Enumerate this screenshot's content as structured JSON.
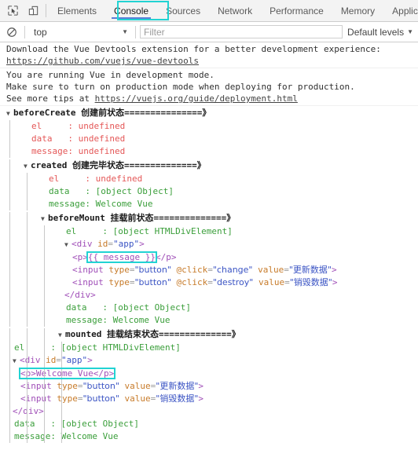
{
  "toolbar": {
    "inspect_icon": "inspect-element-icon",
    "device_icon": "device-toolbar-icon",
    "tabs": [
      {
        "label": "Elements",
        "active": false
      },
      {
        "label": "Console",
        "active": true
      },
      {
        "label": "Sources",
        "active": false
      },
      {
        "label": "Network",
        "active": false
      },
      {
        "label": "Performance",
        "active": false
      },
      {
        "label": "Memory",
        "active": false
      },
      {
        "label": "Applicatio",
        "active": false
      }
    ]
  },
  "filterbar": {
    "clear_icon": "clear-console-icon",
    "context": "top",
    "context_caret": "▼",
    "filter_placeholder": "Filter",
    "filter_value": "",
    "levels_label": "Default levels",
    "levels_caret": "▼"
  },
  "highlights": {
    "accent": "#22d3d3",
    "tab_target": "Console",
    "console_target_1": "{{ message }}",
    "console_target_2": "p>Welcome Vue</p>"
  },
  "console": {
    "messages": [
      {
        "lines": [
          "Download the Vue Devtools extension for a better development experience:",
          "https://github.com/vuejs/vue-devtools"
        ]
      },
      {
        "lines": [
          "You are running Vue in development mode.",
          "Make sure to turn on production mode when deploying for production.",
          "See more tips at https://vuejs.org/guide/deployment.html"
        ]
      }
    ],
    "groups": [
      {
        "name": "beforeCreate",
        "title_cn": "创建前状态",
        "title_rule": "===============》",
        "rows": [
          {
            "key": "el",
            "pad": "     ",
            "sep": ": ",
            "value": "undefined",
            "color": "red"
          },
          {
            "key": "data",
            "pad": "   ",
            "sep": ": ",
            "value": "undefined",
            "color": "red"
          },
          {
            "key": "message",
            "pad": "",
            "sep": ": ",
            "value": "undefined",
            "color": "red"
          }
        ]
      },
      {
        "name": "created",
        "title_cn": "创建完毕状态",
        "title_rule": "==============》",
        "rows": [
          {
            "key": "el",
            "pad": "     ",
            "sep": ": ",
            "value": "undefined",
            "color": "red"
          },
          {
            "key": "data",
            "pad": "   ",
            "sep": ": ",
            "value": "[object Object]",
            "color": "green"
          },
          {
            "key": "message",
            "pad": "",
            "sep": ": ",
            "value": "Welcome Vue",
            "color": "green"
          }
        ]
      },
      {
        "name": "beforeMount",
        "title_cn": "挂载前状态",
        "title_rule": "==============》",
        "rows": [
          {
            "key": "el",
            "pad": "     ",
            "sep": ": ",
            "value": "[object HTMLDivElement]",
            "color": "green"
          }
        ],
        "dom": {
          "open_tag": {
            "lt": "<",
            "name": "div",
            "space": " ",
            "attr": "id",
            "eq": "=",
            "value": "\"app\"",
            "gt": ">"
          },
          "children": [
            {
              "type": "p_mustache",
              "before": "<p>",
              "mustache": "{{ message }}",
              "after": "</p>"
            },
            {
              "type": "input",
              "tag": "<input",
              "attrs": [
                {
                  "name": " type",
                  "eq": "=",
                  "value": "\"button\""
                },
                {
                  "name": " @click",
                  "eq": "=",
                  "value": "\"change\""
                },
                {
                  "name": " value",
                  "eq": "=",
                  "value": "\"更新数据\""
                }
              ],
              "close": ">"
            },
            {
              "type": "input",
              "tag": "<input",
              "attrs": [
                {
                  "name": " type",
                  "eq": "=",
                  "value": "\"button\""
                },
                {
                  "name": " @click",
                  "eq": "=",
                  "value": "\"destroy\""
                },
                {
                  "name": " value",
                  "eq": "=",
                  "value": "\"销毁数据\""
                }
              ],
              "close": ">"
            }
          ],
          "close_tag": "</div>"
        },
        "rows_after": [
          {
            "key": "data",
            "pad": "   ",
            "sep": ": ",
            "value": "[object Object]",
            "color": "green"
          },
          {
            "key": "message",
            "pad": "",
            "sep": ": ",
            "value": "Welcome Vue",
            "color": "green"
          }
        ]
      },
      {
        "name": "mounted",
        "title_cn": "挂载结束状态",
        "title_rule": "==============》",
        "rows": [
          {
            "key": "el",
            "pad": "     ",
            "sep": ": ",
            "value": "[object HTMLDivElement]",
            "color": "green"
          }
        ],
        "dom": {
          "open_tag": {
            "lt": "<",
            "name": "div",
            "space": " ",
            "attr": "id",
            "eq": "=",
            "value": "\"app\"",
            "gt": ">"
          },
          "children": [
            {
              "type": "p_text",
              "text": "<p>Welcome Vue</p>"
            },
            {
              "type": "input",
              "tag": "<input",
              "attrs": [
                {
                  "name": " type",
                  "eq": "=",
                  "value": "\"button\""
                },
                {
                  "name": " value",
                  "eq": "=",
                  "value": "\"更新数据\""
                }
              ],
              "close": ">"
            },
            {
              "type": "input",
              "tag": "<input",
              "attrs": [
                {
                  "name": " type",
                  "eq": "=",
                  "value": "\"button\""
                },
                {
                  "name": " value",
                  "eq": "=",
                  "value": "\"销毁数据\""
                }
              ],
              "close": ">"
            }
          ],
          "close_tag": "</div>"
        },
        "rows_after": [
          {
            "key": "data",
            "pad": "   ",
            "sep": ": ",
            "value": "[object Object]",
            "color": "green"
          },
          {
            "key": "message",
            "pad": "",
            "sep": ": ",
            "value": "Welcome Vue",
            "color": "green"
          }
        ]
      }
    ]
  }
}
